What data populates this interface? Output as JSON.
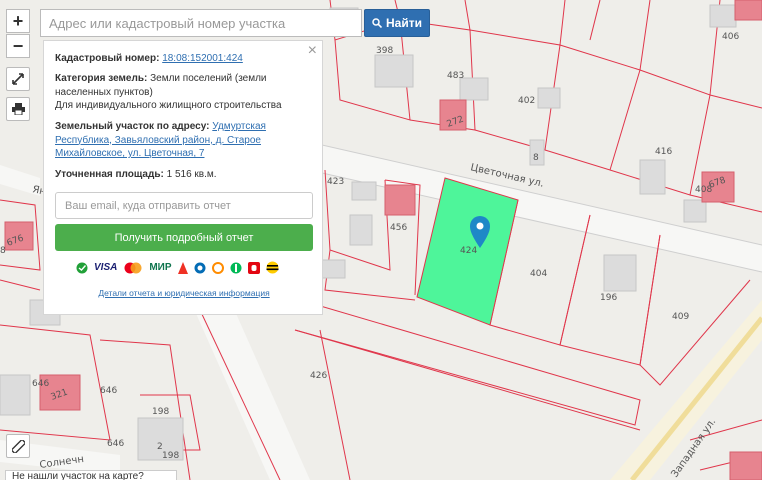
{
  "search": {
    "placeholder": "Адрес или кадастровый номер участка",
    "button_label": "Найти"
  },
  "controls": {
    "zoom_in": "+",
    "zoom_out": "−"
  },
  "panel": {
    "close": "×",
    "cadastral_label": "Кадастровый номер:",
    "cadastral_value": "18:08:152001:424",
    "category_label": "Категория земель:",
    "category_value": "Земли поселений (земли населенных пунктов)",
    "use_value": "Для индивидуального жилищного строительства",
    "address_label": "Земельный участок по адресу:",
    "address_value": "Удмуртская Республика, Завьяловский район, д. Старое Михайловское, ул. Цветочная, 7",
    "area_label": "Уточненная площадь:",
    "area_value": "1 516 кв.м.",
    "email_placeholder": "Ваш email, куда отправить отчет",
    "report_button": "Получить подробный отчет",
    "details_link": "Детали отчета и юридическая информация",
    "payments": [
      {
        "name": "sberbank-icon",
        "label": ""
      },
      {
        "name": "visa-icon",
        "label": "VISA"
      },
      {
        "name": "mastercard-icon",
        "label": ""
      },
      {
        "name": "mir-icon",
        "label": "МИР"
      },
      {
        "name": "alfa-icon",
        "label": ""
      },
      {
        "name": "webmoney-icon",
        "label": ""
      },
      {
        "name": "qiwi-icon",
        "label": ""
      },
      {
        "name": "megafon-icon",
        "label": ""
      },
      {
        "name": "mts-icon",
        "label": ""
      },
      {
        "name": "beeline-icon",
        "label": ""
      }
    ]
  },
  "map": {
    "selected_parcel_color": "#4ef59a",
    "parcel_line_color": "#e0364b",
    "parcel_labels": [
      "398",
      "483",
      "402",
      "406",
      "416",
      "408",
      "423",
      "456",
      "424",
      "404",
      "196",
      "409",
      "426",
      "646",
      "646",
      "198",
      "198",
      "646",
      "2",
      "8",
      "676",
      "678",
      "272",
      "321",
      "8"
    ],
    "street_labels": [
      "Цветочная ул.",
      "Ян",
      "Солнечн",
      "Западная ул."
    ]
  },
  "bottom_bar": {
    "text": "Не нашли участок на карте?"
  },
  "colors": {
    "accent": "#2f6fb1",
    "success": "#4cae4c",
    "marker": "#1e88c7"
  }
}
